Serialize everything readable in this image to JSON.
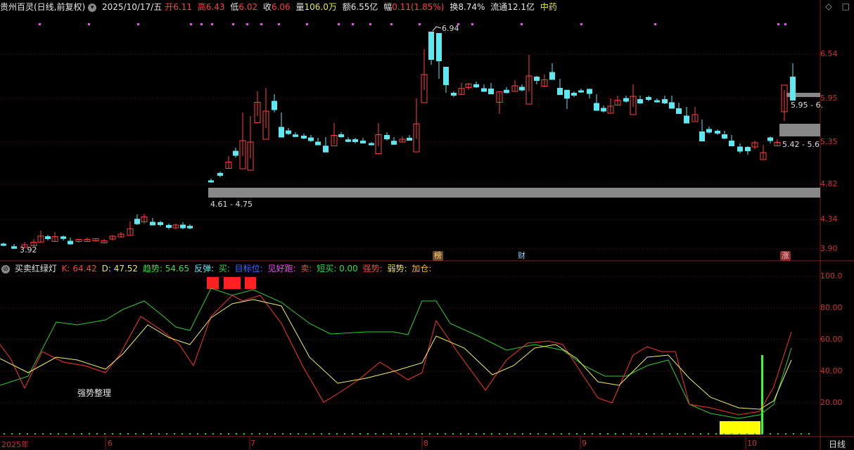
{
  "header": {
    "stock": "贵州百灵(日线,前复权)",
    "date": "2025/10/17/五",
    "open_label": "开",
    "open": "6.11",
    "high_label": "高",
    "high": "6.43",
    "low_label": "低",
    "low": "6.02",
    "close_label": "收",
    "close": "6.06",
    "vol_label": "量",
    "vol": "106.0万",
    "amount_label": "额",
    "amount": "6.55亿",
    "chg_label": "幅",
    "chg": "0.11(1.85%)",
    "turnover_label": "换",
    "turnover": "8.74%",
    "float_label": "流通",
    "float": "12.1亿",
    "sector": "中药"
  },
  "window_icons": [
    "◇",
    "□"
  ],
  "price_axis": [
    "6.54",
    "5.95",
    "5.35",
    "4.82",
    "4.34",
    "3.90"
  ],
  "indicator_axis": [
    "100.0",
    "80.00",
    "60.00",
    "40.00",
    "20.00"
  ],
  "annotations": {
    "high_marker": "6.94",
    "low_marker": "3.92",
    "zone1": "4.61 - 4.75",
    "zone2": "5.95 - 6.",
    "zone3": "5.42 - 5.6",
    "indicator_text": "强势整理"
  },
  "badges": [
    "榜",
    "财",
    "涨"
  ],
  "indicator_header": {
    "name": "买卖红绿灯",
    "k_label": "K: ",
    "k": "64.42",
    "d_label": "D: ",
    "d": "47.52",
    "trend_label": "趋势: ",
    "trend": "54.65",
    "rebound_label": "反弹: ",
    "buy_label": "买: ",
    "target_label": "目标位: ",
    "take_profit_label": "见好跑: ",
    "sell_label": "卖: ",
    "short_buy_label": "短买: ",
    "short_buy": "0.00",
    "strong_label": "强势: ",
    "weak_label": "弱势: ",
    "add_label": "加仓: "
  },
  "time_axis": {
    "year": "2025年",
    "months": [
      "6",
      "7",
      "8",
      "9",
      "10"
    ],
    "period": "日线"
  },
  "colors": {
    "up": "#ff4040",
    "down": "#5ee8f0",
    "k_line": "#ff3030",
    "d_line": "#f0f060",
    "trend_line": "#30cc30",
    "zone": "#888888",
    "yellow_box": "#ffff00",
    "red_blocks": "#ff2020"
  }
}
